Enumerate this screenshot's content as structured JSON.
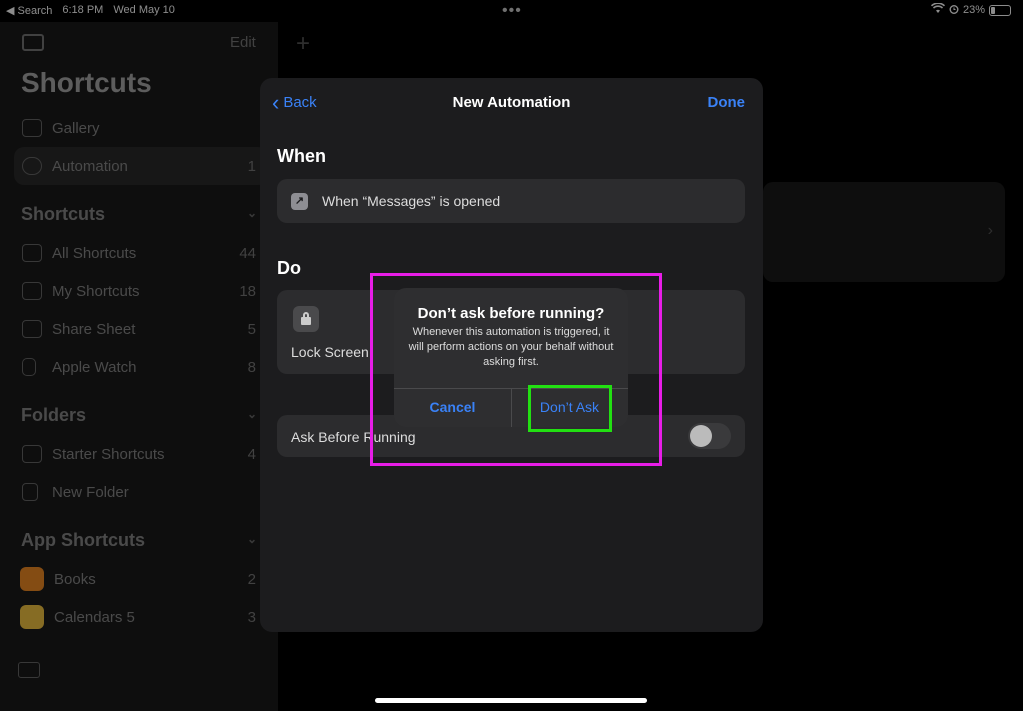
{
  "status_bar": {
    "back_app": "◀ Search",
    "time": "6:18 PM",
    "date": "Wed May 10",
    "battery": "23%",
    "battery_level": 0.23
  },
  "sidebar": {
    "edit_label": "Edit",
    "title": "Shortcuts",
    "top_items": [
      {
        "label": "Gallery",
        "icon": "gallery-icon"
      },
      {
        "label": "Automation",
        "count": "1",
        "icon": "automation-icon",
        "selected": true
      }
    ],
    "sections": [
      {
        "title": "Shortcuts",
        "items": [
          {
            "label": "All Shortcuts",
            "count": "44",
            "icon": "grid-icon"
          },
          {
            "label": "My Shortcuts",
            "count": "18",
            "icon": "person-icon"
          },
          {
            "label": "Share Sheet",
            "count": "5",
            "icon": "share-icon"
          },
          {
            "label": "Apple Watch",
            "count": "8",
            "icon": "watch-icon"
          }
        ]
      },
      {
        "title": "Folders",
        "items": [
          {
            "label": "Starter Shortcuts",
            "count": "4",
            "icon": "folder-icon"
          },
          {
            "label": "New Folder",
            "icon": "new-folder-icon"
          }
        ]
      },
      {
        "title": "App Shortcuts",
        "items": [
          {
            "label": "Books",
            "count": "2",
            "icon": "books-app-icon",
            "color": "#f08a24"
          },
          {
            "label": "Calendars 5",
            "count": "3",
            "icon": "calendars-app-icon",
            "color": "#f5c542"
          }
        ]
      }
    ]
  },
  "sheet": {
    "back_label": "Back",
    "title": "New Automation",
    "done_label": "Done",
    "when_header": "When",
    "trigger_text": "When “Messages” is opened",
    "do_header": "Do",
    "action_label": "Lock Screen",
    "ask_label": "Ask Before Running",
    "ask_toggle_on": false
  },
  "alert": {
    "title": "Don’t ask before running?",
    "message": "Whenever this automation is triggered, it will perform actions on your behalf without asking first.",
    "cancel_label": "Cancel",
    "confirm_label": "Don’t Ask"
  },
  "colors": {
    "accent": "#3a82f7",
    "highlight_outer": "#e81de8",
    "highlight_inner": "#22e012"
  }
}
